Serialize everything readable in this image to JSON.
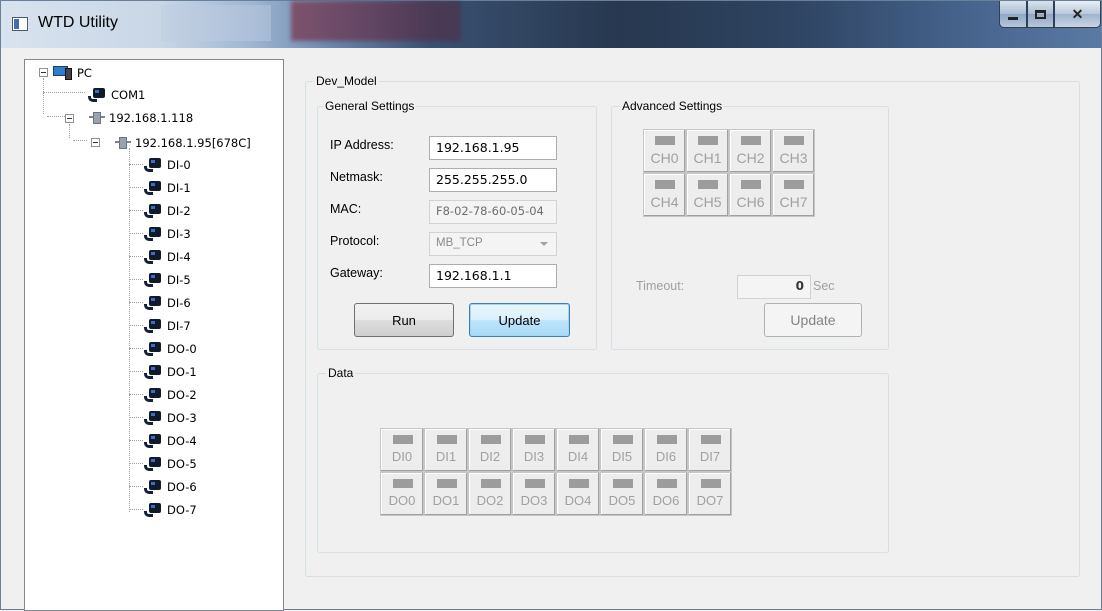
{
  "window": {
    "title": "WTD Utility"
  },
  "tree": {
    "root": "PC",
    "com": "COM1",
    "host": "192.168.1.118",
    "device": "192.168.1.95[678C]",
    "channels": [
      "DI-0",
      "DI-1",
      "DI-2",
      "DI-3",
      "DI-4",
      "DI-5",
      "DI-6",
      "DI-7",
      "DO-0",
      "DO-1",
      "DO-2",
      "DO-3",
      "DO-4",
      "DO-5",
      "DO-6",
      "DO-7"
    ]
  },
  "dev_model": {
    "title": "Dev_Model"
  },
  "general": {
    "title": "General Settings",
    "ip_label": "IP Address:",
    "ip_value": "192.168.1.95",
    "netmask_label": "Netmask:",
    "netmask_value": "255.255.255.0",
    "mac_label": "MAC:",
    "mac_value": "F8-02-78-60-05-04",
    "protocol_label": "Protocol:",
    "protocol_value": "MB_TCP",
    "gateway_label": "Gateway:",
    "gateway_value": "192.168.1.1",
    "run_label": "Run",
    "update_label": "Update"
  },
  "advanced": {
    "title": "Advanced Settings",
    "channels": [
      "CH0",
      "CH1",
      "CH2",
      "CH3",
      "CH4",
      "CH5",
      "CH6",
      "CH7"
    ],
    "timeout_label": "Timeout:",
    "timeout_value": "0",
    "timeout_unit": "Sec",
    "update_label": "Update"
  },
  "data": {
    "title": "Data",
    "di": [
      "DI0",
      "DI1",
      "DI2",
      "DI3",
      "DI4",
      "DI5",
      "DI6",
      "DI7"
    ],
    "do": [
      "DO0",
      "DO1",
      "DO2",
      "DO3",
      "DO4",
      "DO5",
      "DO6",
      "DO7"
    ]
  }
}
